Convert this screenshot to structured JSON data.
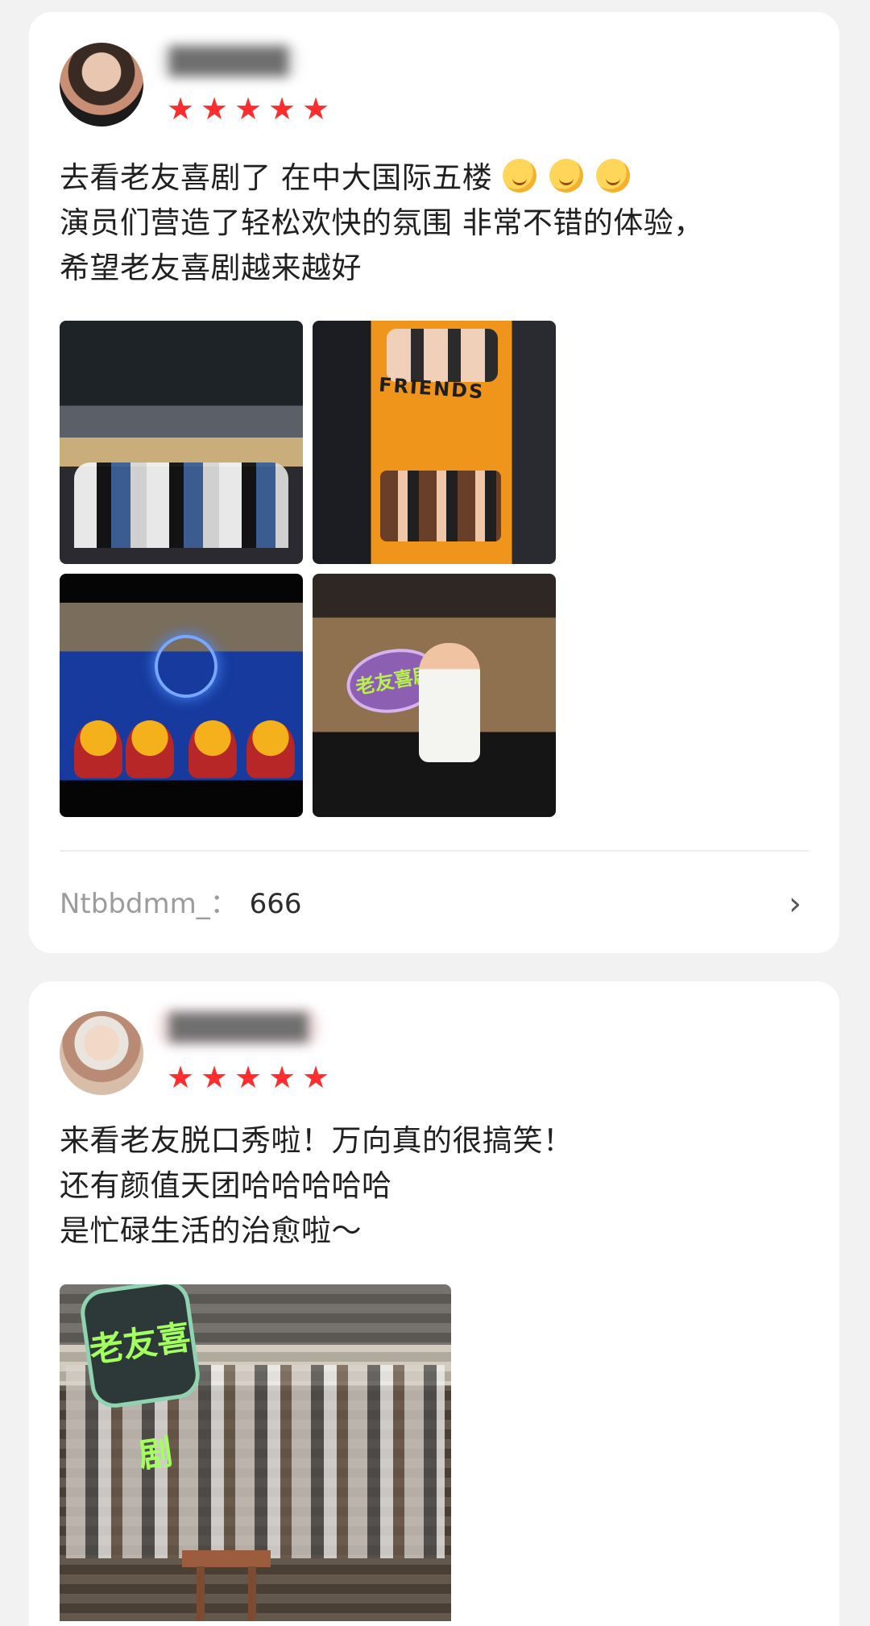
{
  "review1": {
    "rating_stars": 5,
    "text_lines": [
      "去看老友喜剧了 在中大国际五楼",
      "演员们营造了轻松欢快的氛围 非常不错的体验，",
      "希望老友喜剧越来越好"
    ],
    "emoji_icons": [
      "face-emoji-icon",
      "face-emoji-icon",
      "face-emoji-icon"
    ],
    "photo_text": {
      "poster_title": "FRIENDS",
      "stage_sign": "老友喜剧"
    },
    "comment": {
      "user": "Ntbbdmm_：",
      "text": "666"
    }
  },
  "review2": {
    "rating_stars": 5,
    "text_lines": [
      "来看老友脱口秀啦！万向真的很搞笑！",
      "还有颜值天团哈哈哈哈哈",
      "是忙碌生活的治愈啦～"
    ],
    "photo_text": {
      "stage_sign": "老友喜剧"
    }
  },
  "colors": {
    "background": "#f2f2f2",
    "card": "#ffffff",
    "star": "#ff2d2d",
    "comment_user": "#9c9c9c"
  }
}
